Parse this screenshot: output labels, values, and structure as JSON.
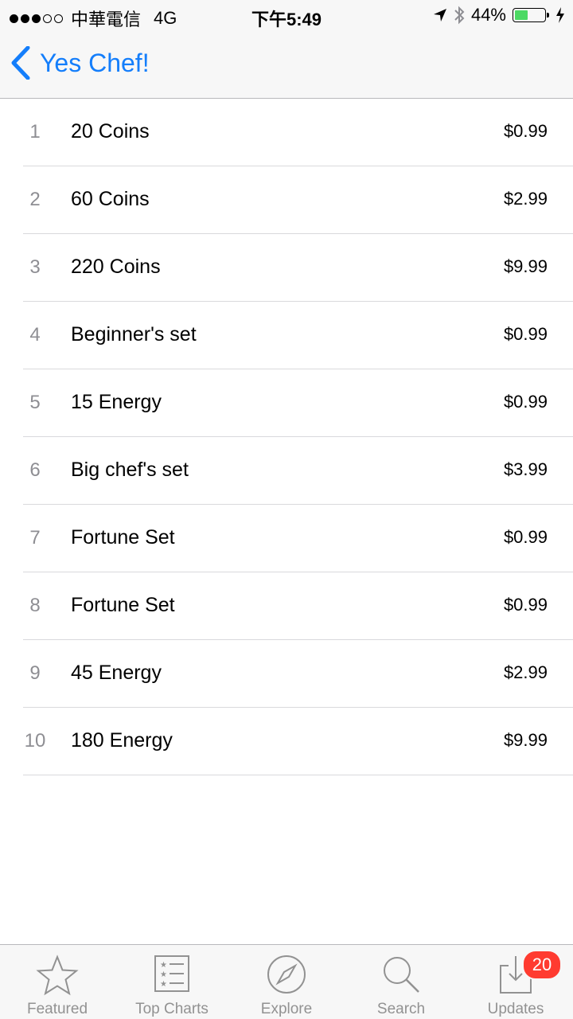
{
  "status_bar": {
    "carrier": "中華電信",
    "network": "4G",
    "time": "下午5:49",
    "battery_percent": "44%",
    "battery_level": 0.44,
    "signal_bars": 3,
    "colors": {
      "battery_fill": "#4cd964"
    }
  },
  "nav": {
    "back_label": "Yes Chef!",
    "accent_color": "#147efb"
  },
  "purchases": [
    {
      "rank": "1",
      "name": "20 Coins",
      "price": "$0.99"
    },
    {
      "rank": "2",
      "name": "60 Coins",
      "price": "$2.99"
    },
    {
      "rank": "3",
      "name": "220 Coins",
      "price": "$9.99"
    },
    {
      "rank": "4",
      "name": "Beginner's set",
      "price": "$0.99"
    },
    {
      "rank": "5",
      "name": "15 Energy",
      "price": "$0.99"
    },
    {
      "rank": "6",
      "name": "Big chef's set",
      "price": "$3.99"
    },
    {
      "rank": "7",
      "name": "Fortune Set",
      "price": "$0.99"
    },
    {
      "rank": "8",
      "name": "Fortune Set",
      "price": "$0.99"
    },
    {
      "rank": "9",
      "name": "45 Energy",
      "price": "$2.99"
    },
    {
      "rank": "10",
      "name": "180 Energy",
      "price": "$9.99"
    }
  ],
  "tabbar": {
    "tabs": [
      {
        "label": "Featured",
        "icon": "star-icon"
      },
      {
        "label": "Top Charts",
        "icon": "list-icon"
      },
      {
        "label": "Explore",
        "icon": "compass-icon"
      },
      {
        "label": "Search",
        "icon": "search-icon"
      },
      {
        "label": "Updates",
        "icon": "download-icon"
      }
    ],
    "updates_badge": "20",
    "badge_color": "#ff3b30"
  }
}
